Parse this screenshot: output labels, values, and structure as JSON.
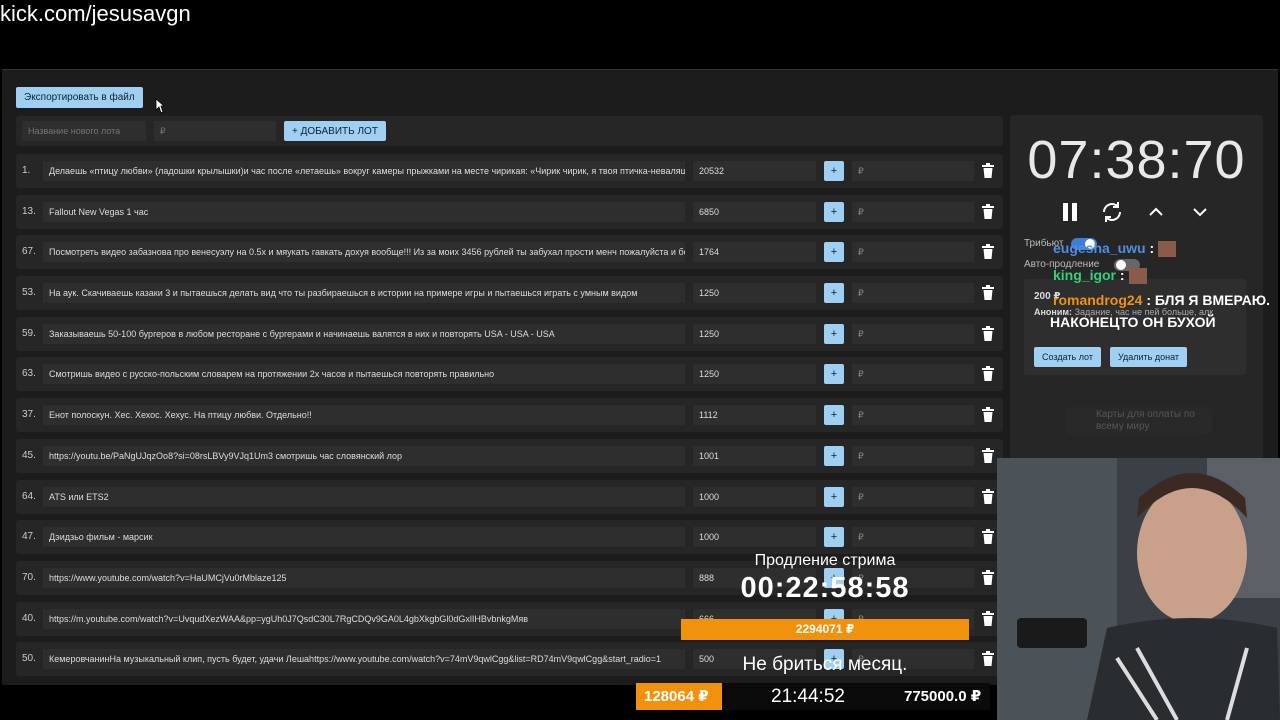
{
  "url": "kick.com/jesusavgn",
  "toolbar": {
    "export_label": "Экспортировать в файл"
  },
  "add_lot": {
    "name_placeholder": "Название нового лота",
    "price_placeholder": "₽",
    "add_label": "+ ДОБАВИТЬ ЛОТ"
  },
  "lots": [
    {
      "num": "1.",
      "title": "Делаешь «птицу любви» (ладошки крылышки)и час после «летаешь» вокруг камеры прыжками на месте чирикая: «Чирик чирик, я твоя птичка-неваляшка",
      "amount": "20532",
      "plus": "+",
      "rub": "₽"
    },
    {
      "num": "13.",
      "title": "Fallout New Vegas 1 час",
      "amount": "6850",
      "plus": "+",
      "rub": "₽"
    },
    {
      "num": "67.",
      "title": "Посмотреть видео забазнова про венесуэлу на 0.5х и мяукать гавкать дохуя вообще!!! Из за моих 3456 рублей ты забухал прости менч пожалуйста и бо",
      "amount": "1764",
      "plus": "+",
      "rub": "₽"
    },
    {
      "num": "53.",
      "title": "На аук. Скачиваешь казаки 3 и пытаешься делать вид что ты разбираешься в истории на примере игры и пытаешься играть с умным видом",
      "amount": "1250",
      "plus": "+",
      "rub": "₽"
    },
    {
      "num": "59.",
      "title": "Заказываешь 50-100 бургеров в любом ресторане с бургерами и начинаешь валятся в них и повторять USA - USA - USA",
      "amount": "1250",
      "plus": "+",
      "rub": "₽"
    },
    {
      "num": "63.",
      "title": "Смотришь видео с русско-польским словарем на протяжении 2х часов и пытаешься повторять правильно",
      "amount": "1250",
      "plus": "+",
      "rub": "₽"
    },
    {
      "num": "37.",
      "title": "Енот полоскун. Хес. Хехос. Хехус. На птицу любви. Отдельно!!",
      "amount": "1112",
      "plus": "+",
      "rub": "₽"
    },
    {
      "num": "45.",
      "title": "https://youtu.be/PaNgUJqzOo8?si=08rsLBVy9VJq1Um3 смотришь час словянский лор",
      "amount": "1001",
      "plus": "+",
      "rub": "₽"
    },
    {
      "num": "64.",
      "title": "ATS или ETS2",
      "amount": "1000",
      "plus": "+",
      "rub": "₽"
    },
    {
      "num": "47.",
      "title": "Дэидзьо фильм - марсик",
      "amount": "1000",
      "plus": "+",
      "rub": "₽"
    },
    {
      "num": "70.",
      "title": "https://www.youtube.com/watch?v=HaUMCjVu0rMblaze125",
      "amount": "888",
      "plus": "+",
      "rub": "₽"
    },
    {
      "num": "40.",
      "title": "https://m.youtube.com/watch?v=UvqudXezWAA&pp=ygUh0J7QsdC30L7RgCDQv9GA0L4gbXkgbGl0dGxlIHBvbnkgMяв",
      "amount": "666",
      "plus": "+",
      "rub": "₽"
    },
    {
      "num": "50.",
      "title": "КемеровчанинНа музыкальный клип, пусть будет, удачи Лешаhttps://www.youtube.com/watch?v=74mV9qwlCgg&list=RD74mV9qwlCgg&start_radio=1",
      "amount": "500",
      "plus": "+",
      "rub": "₽"
    }
  ],
  "timer": {
    "time": "07:38:70",
    "toggles": [
      {
        "label": "Трибьют",
        "on": true
      },
      {
        "label": "Авто-продление",
        "on": false
      }
    ]
  },
  "donation": {
    "amount": "200 ₽",
    "sender": "Аноним:",
    "text": "Задание, час не пей больше, алк",
    "create_label": "Создать лот",
    "delete_label": "Удалить донат"
  },
  "cards_ad": "Карты для оплаты по всему миру",
  "chat": [
    {
      "user": "eugesha_uwu",
      "sep": " :",
      "text": "",
      "color": "#4d8fe0"
    },
    {
      "user": "king_igor",
      "sep": " :",
      "text": "",
      "color": "#36d07a"
    },
    {
      "user": "romandrog24",
      "sep": " :",
      "text": "БЛЯ Я ВМЕРАЮ.",
      "color": "#f0920e"
    },
    {
      "user": "",
      "sep": "",
      "text": "НАКОНЕЦТО ОН БУХОЙ",
      "color": "#ffffff"
    }
  ],
  "overlay": {
    "ext_label": "Продление стрима",
    "ext_time": "00:22:58:58",
    "goal": "2294071 ₽",
    "task": "Не бриться месяц.",
    "bottom_left": "128064 ₽",
    "bottom_time": "21:44:52",
    "bottom_right": "775000.0 ₽"
  },
  "colors": {
    "accent_button": "#9fd0f2",
    "overlay_orange": "#f0920e",
    "panel": "#262626",
    "input": "#2e2e2e"
  }
}
